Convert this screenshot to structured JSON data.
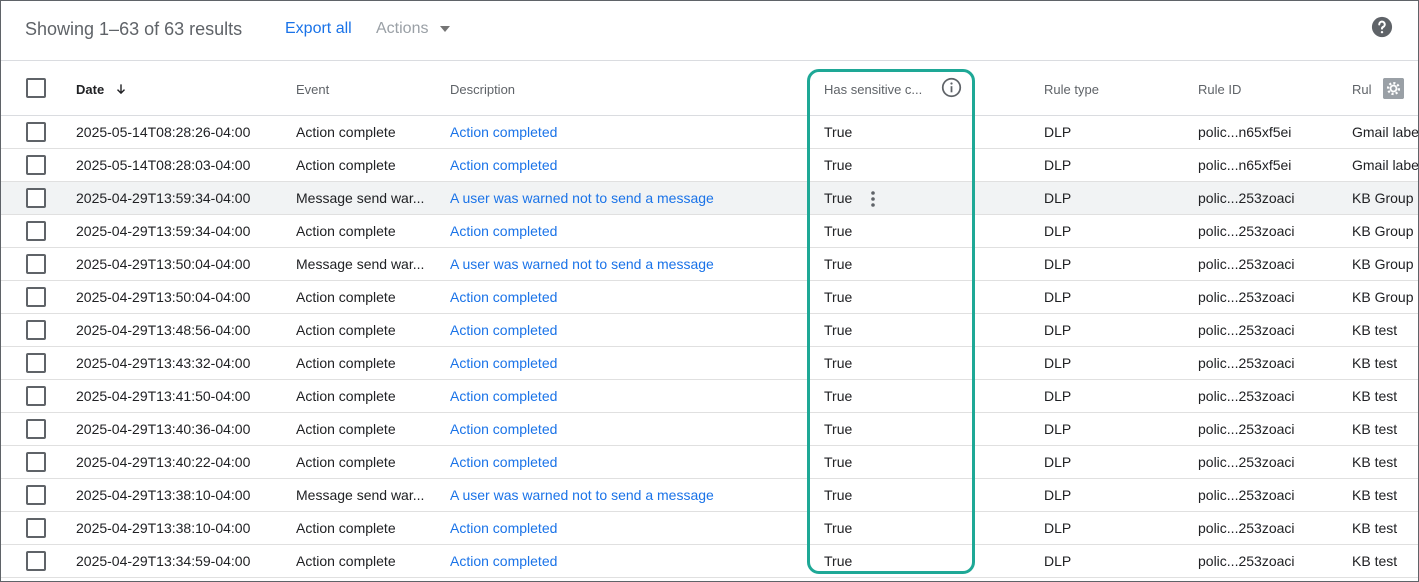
{
  "toolbar": {
    "results_text": "Showing 1–63 of 63 results",
    "export_label": "Export all",
    "actions_label": "Actions"
  },
  "columns": {
    "date": "Date",
    "event": "Event",
    "description": "Description",
    "sensitive": "Has sensitive c...",
    "rule_type": "Rule type",
    "rule_id": "Rule ID",
    "rule": "Rul"
  },
  "icons": {
    "sort": "arrow-down-icon",
    "info": "info-icon",
    "help": "help-icon",
    "settings": "gear-icon",
    "more": "more-vert-icon"
  },
  "colors": {
    "link": "#1a73e8",
    "highlight_border": "#1ea896"
  },
  "rows": [
    {
      "date": "2025-05-14T08:28:26-04:00",
      "event": "Action complete",
      "description": "Action completed",
      "sensitive": "True",
      "rule_type": "DLP",
      "rule_id": "polic...n65xf5ei",
      "rule": "Gmail labe"
    },
    {
      "date": "2025-05-14T08:28:03-04:00",
      "event": "Action complete",
      "description": "Action completed",
      "sensitive": "True",
      "rule_type": "DLP",
      "rule_id": "polic...n65xf5ei",
      "rule": "Gmail labe"
    },
    {
      "date": "2025-04-29T13:59:34-04:00",
      "event": "Message send war...",
      "description": "A user was warned not to send a message",
      "sensitive": "True",
      "rule_type": "DLP",
      "rule_id": "polic...253zoaci",
      "rule": "KB Group E",
      "hover": true
    },
    {
      "date": "2025-04-29T13:59:34-04:00",
      "event": "Action complete",
      "description": "Action completed",
      "sensitive": "True",
      "rule_type": "DLP",
      "rule_id": "polic...253zoaci",
      "rule": "KB Group E"
    },
    {
      "date": "2025-04-29T13:50:04-04:00",
      "event": "Message send war...",
      "description": "A user was warned not to send a message",
      "sensitive": "True",
      "rule_type": "DLP",
      "rule_id": "polic...253zoaci",
      "rule": "KB Group E"
    },
    {
      "date": "2025-04-29T13:50:04-04:00",
      "event": "Action complete",
      "description": "Action completed",
      "sensitive": "True",
      "rule_type": "DLP",
      "rule_id": "polic...253zoaci",
      "rule": "KB Group E"
    },
    {
      "date": "2025-04-29T13:48:56-04:00",
      "event": "Action complete",
      "description": "Action completed",
      "sensitive": "True",
      "rule_type": "DLP",
      "rule_id": "polic...253zoaci",
      "rule": "KB test"
    },
    {
      "date": "2025-04-29T13:43:32-04:00",
      "event": "Action complete",
      "description": "Action completed",
      "sensitive": "True",
      "rule_type": "DLP",
      "rule_id": "polic...253zoaci",
      "rule": "KB test"
    },
    {
      "date": "2025-04-29T13:41:50-04:00",
      "event": "Action complete",
      "description": "Action completed",
      "sensitive": "True",
      "rule_type": "DLP",
      "rule_id": "polic...253zoaci",
      "rule": "KB test"
    },
    {
      "date": "2025-04-29T13:40:36-04:00",
      "event": "Action complete",
      "description": "Action completed",
      "sensitive": "True",
      "rule_type": "DLP",
      "rule_id": "polic...253zoaci",
      "rule": "KB test"
    },
    {
      "date": "2025-04-29T13:40:22-04:00",
      "event": "Action complete",
      "description": "Action completed",
      "sensitive": "True",
      "rule_type": "DLP",
      "rule_id": "polic...253zoaci",
      "rule": "KB test"
    },
    {
      "date": "2025-04-29T13:38:10-04:00",
      "event": "Message send war...",
      "description": "A user was warned not to send a message",
      "sensitive": "True",
      "rule_type": "DLP",
      "rule_id": "polic...253zoaci",
      "rule": "KB test"
    },
    {
      "date": "2025-04-29T13:38:10-04:00",
      "event": "Action complete",
      "description": "Action completed",
      "sensitive": "True",
      "rule_type": "DLP",
      "rule_id": "polic...253zoaci",
      "rule": "KB test"
    },
    {
      "date": "2025-04-29T13:34:59-04:00",
      "event": "Action complete",
      "description": "Action completed",
      "sensitive": "True",
      "rule_type": "DLP",
      "rule_id": "polic...253zoaci",
      "rule": "KB test"
    }
  ]
}
